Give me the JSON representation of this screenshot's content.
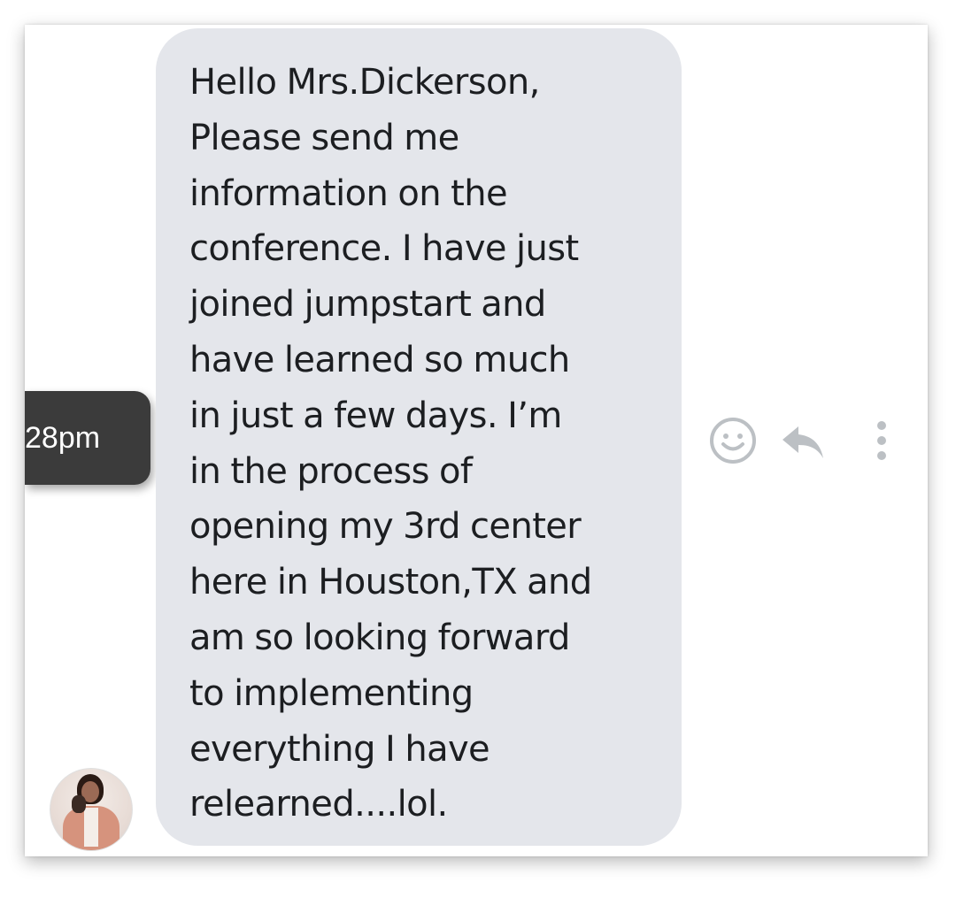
{
  "message": {
    "lines": [
      "Hello Mrs.Dickerson,",
      "Please send me",
      "information on the",
      "conference. I have just",
      "joined jumpstart and",
      "have learned so much",
      "in just a few days. I’m",
      "in the process of",
      "opening my 3rd center",
      "here in Houston,TX and",
      "am so looking forward",
      "to implementing",
      "everything I have",
      "relearned....lol."
    ],
    "timestamp": "28pm",
    "bubble_color": "#e4e6eb",
    "text_color": "#1c1e21"
  },
  "actions": {
    "react_icon": "smiley-icon",
    "reply_icon": "reply-arrow-icon",
    "more_icon": "vertical-ellipsis-icon",
    "icon_color": "#bcc0c4"
  },
  "sender": {
    "avatar": "sender-avatar"
  }
}
